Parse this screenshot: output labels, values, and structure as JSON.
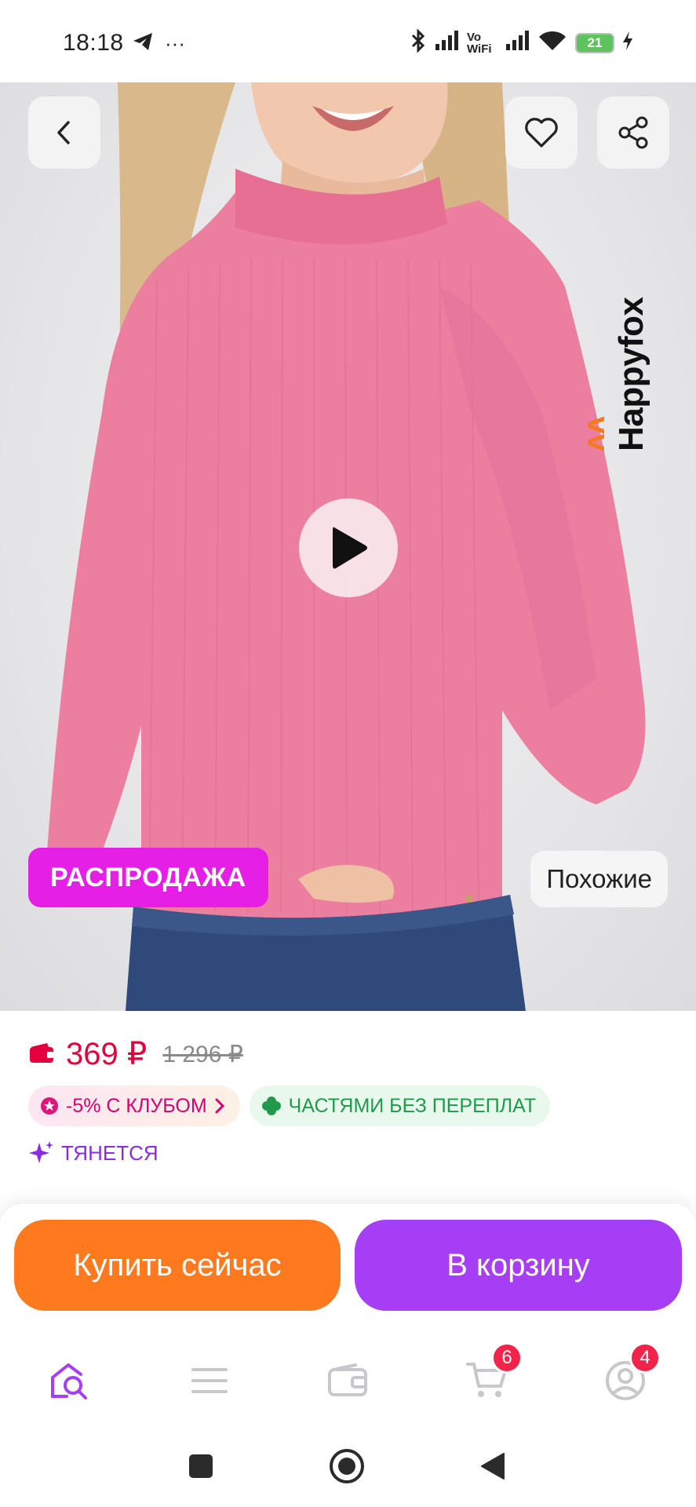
{
  "status_bar": {
    "time": "18:18",
    "more": "···",
    "vowifi": "Vo WiFi",
    "battery": "21"
  },
  "hero": {
    "brand": "Happyfox",
    "sale_label": "РАСПРОДАЖА",
    "similar_label": "Похожие"
  },
  "price": {
    "current": "369 ₽",
    "old": "1 296 ₽"
  },
  "chips": {
    "club": "-5% С КЛУБОМ",
    "parts": "ЧАСТЯМИ БЕЗ ПЕРЕПЛАТ"
  },
  "feature_tag": "ТЯНЕТСЯ",
  "actions": {
    "buy_now": "Купить сейчас",
    "add_to_cart": "В корзину"
  },
  "bottom_nav": {
    "cart_badge": "6",
    "profile_badge": "4"
  },
  "colors": {
    "accent_purple": "#a53ef5",
    "accent_orange": "#ff7a1f",
    "sale_magenta": "#e61fe6",
    "price_red": "#e4003c"
  }
}
